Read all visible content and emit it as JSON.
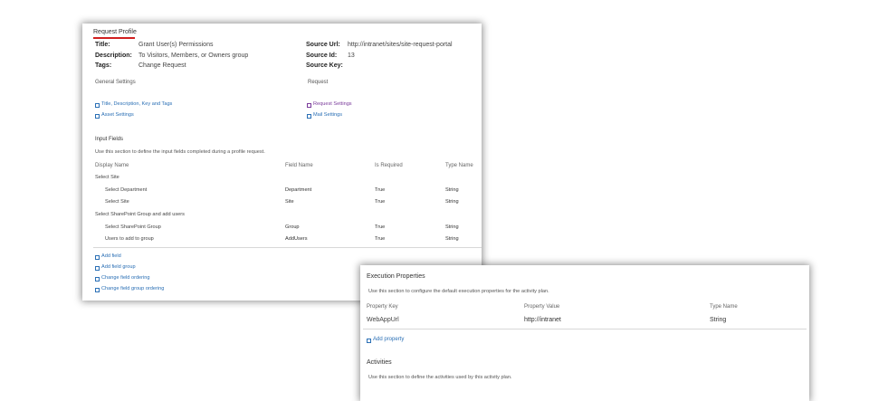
{
  "profile": {
    "tab_label": "Request Profile",
    "title_label": "Title:",
    "title_value": "Grant User(s) Permissions",
    "description_label": "Description:",
    "description_value": "To Visitors, Members, or Owners group",
    "tags_label": "Tags:",
    "tags_value": "Change Request",
    "source_url_label": "Source Url:",
    "source_url_value": "http://intranet/sites/site-request-portal",
    "source_id_label": "Source Id:",
    "source_id_value": "13",
    "source_key_label": "Source Key:",
    "general_settings_heading": "General Settings",
    "request_heading": "Request",
    "general_links": [
      "Title, Description, Key and Tags",
      "Asset Settings"
    ],
    "request_links": [
      "Request Settings",
      "Mail Settings"
    ]
  },
  "input_fields": {
    "heading": "Input Fields",
    "description": "Use this section to define the input fields completed during a profile request.",
    "columns": [
      "Display Name",
      "Field Name",
      "Is Required",
      "Type Name"
    ],
    "rows": [
      {
        "kind": "group",
        "display": "Select Site"
      },
      {
        "kind": "field",
        "display": "Select Department",
        "field": "Department",
        "required": "True",
        "type": "String"
      },
      {
        "kind": "field",
        "display": "Select Site",
        "field": "Site",
        "required": "True",
        "type": "String"
      },
      {
        "kind": "group",
        "display": "Select SharePoint Group and add users"
      },
      {
        "kind": "field",
        "display": "Select SharePoint Group",
        "field": "Group",
        "required": "True",
        "type": "String"
      },
      {
        "kind": "field",
        "display": "Users to add to group",
        "field": "AddUsers",
        "required": "True",
        "type": "String"
      }
    ],
    "actions": [
      "Add field",
      "Add field group",
      "Change field ordering",
      "Change field group ordering"
    ]
  },
  "execution": {
    "heading": "Execution Properties",
    "description": "Use this section to configure the default execution properties for the activity plan.",
    "columns": [
      "Property Key",
      "Property Value",
      "Type Name"
    ],
    "rows": [
      {
        "key": "WebAppUrl",
        "value": "http://intranet",
        "type": "String"
      }
    ],
    "add_label": "Add property"
  },
  "activities": {
    "heading": "Activities",
    "description": "Use this section to define the activities used by this activity plan."
  },
  "colors": {
    "link": "#2a6fb5",
    "visited_link": "#7a3a9a",
    "tab_underline": "#d02020"
  }
}
